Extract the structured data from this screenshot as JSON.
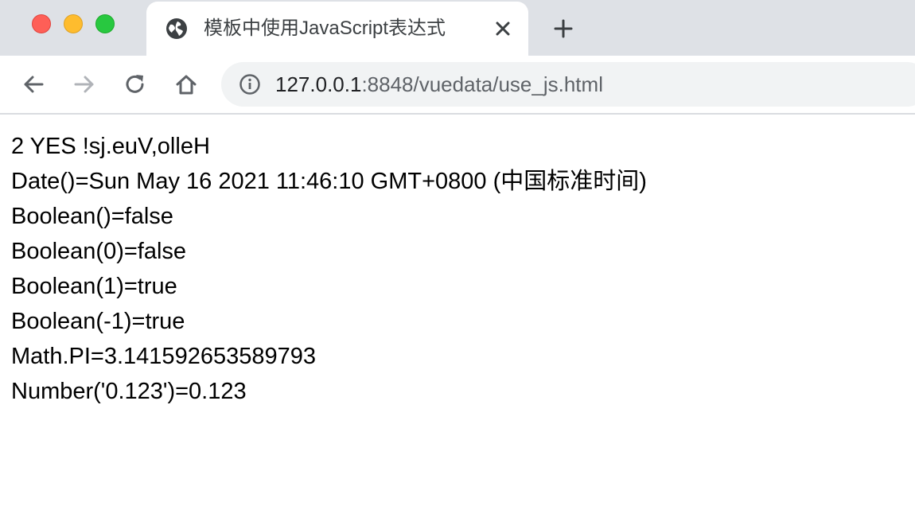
{
  "window": {
    "traffic_lights": {
      "close_color": "#fe5f57",
      "minimize_color": "#febc2e",
      "maximize_color": "#28c840"
    }
  },
  "tab": {
    "title": "模板中使用JavaScript表达式",
    "favicon": "globe-icon",
    "close_icon": "close-icon"
  },
  "new_tab": {
    "icon": "plus-icon"
  },
  "toolbar": {
    "back_icon": "arrow-left-icon",
    "forward_icon": "arrow-right-icon",
    "reload_icon": "reload-icon",
    "home_icon": "home-icon"
  },
  "address_bar": {
    "info_icon": "info-icon",
    "url_host": "127.0.0.1",
    "url_rest": ":8848/vuedata/use_js.html"
  },
  "page": {
    "lines": [
      "2 YES !sj.euV,olleH",
      "Date()=Sun May 16 2021 11:46:10 GMT+0800 (中国标准时间)",
      "Boolean()=false",
      "Boolean(0)=false",
      "Boolean(1)=true",
      "Boolean(-1)=true",
      "Math.PI=3.141592653589793",
      "Number('0.123')=0.123"
    ]
  }
}
